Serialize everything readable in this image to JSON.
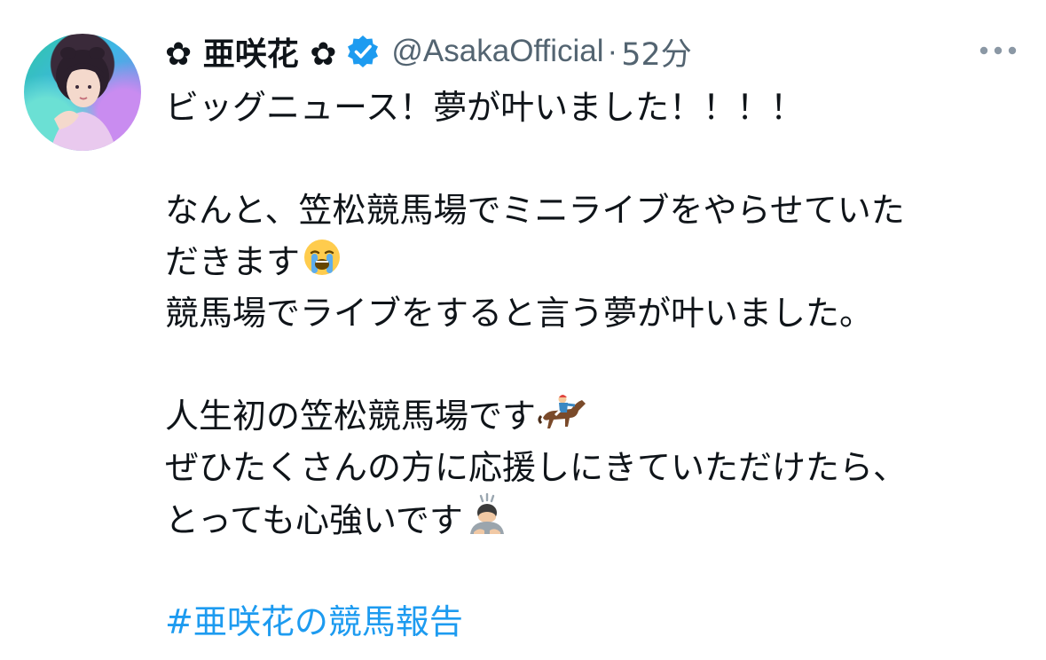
{
  "tweet": {
    "display_name": "✿ 亜咲花 ✿",
    "handle": "@AsakaOfficial",
    "separator": "·",
    "timestamp": "52分",
    "lines": [
      "ビッグニュース！夢が叶いました！！！！",
      "",
      "なんと、笠松競馬場でミニライブをやらせていた",
      "だきます",
      "競馬場でライブをすると言う夢が叶いました。",
      "",
      "人生初の笠松競馬場です",
      "ぜひたくさんの方に応援しにきていただけたら、",
      "とっても心強いです",
      ""
    ],
    "hashtag": "#亜咲花の競馬報告",
    "icons": {
      "verified": "verified-badge-icon",
      "more": "more-options-icon",
      "crying": "loudly-crying-face-emoji",
      "horse": "horse-racing-emoji",
      "bow": "person-bowing-emoji"
    },
    "colors": {
      "text": "#0f1419",
      "secondary": "#536471",
      "link": "#1d9bf0"
    }
  }
}
